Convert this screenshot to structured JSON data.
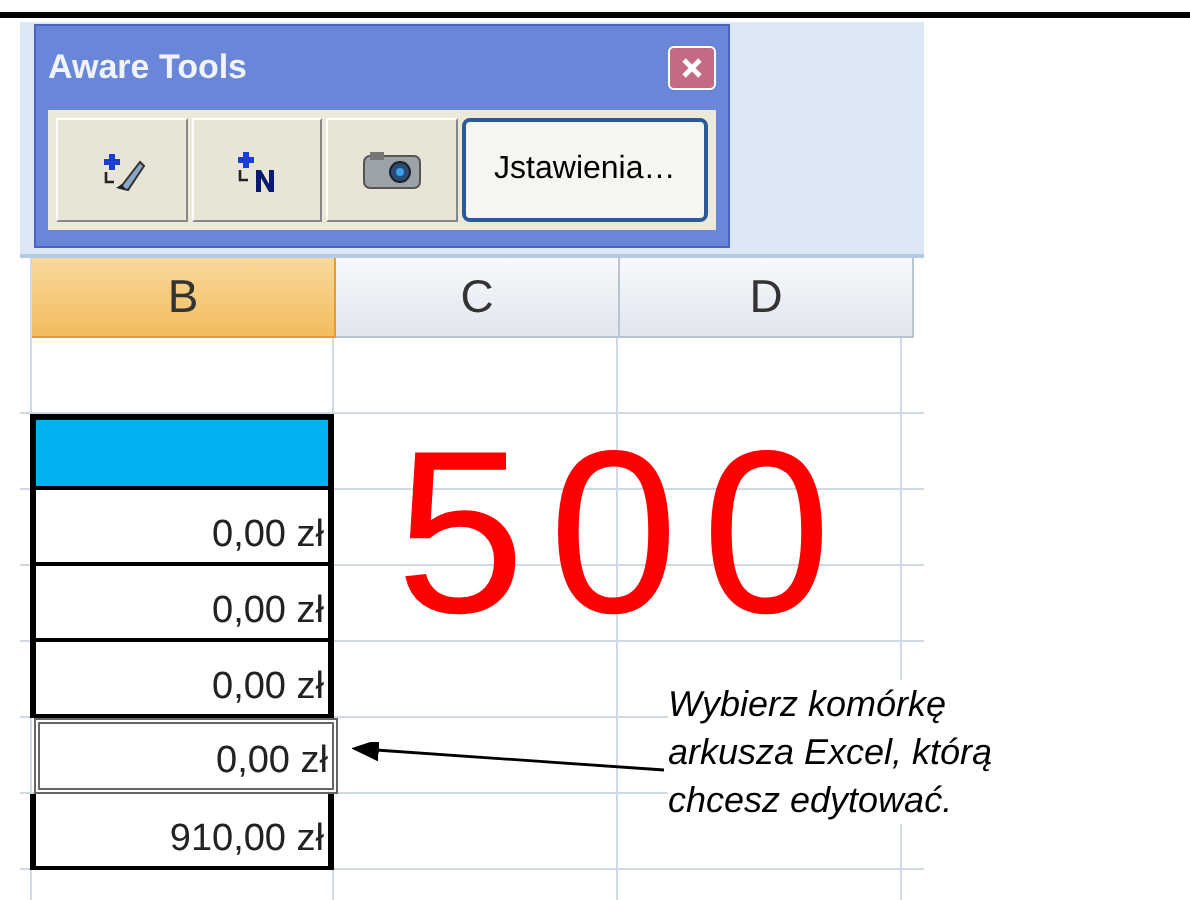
{
  "toolbar_window": {
    "title": "Aware Tools",
    "buttons": [
      {
        "kind": "icon"
      },
      {
        "kind": "icon"
      },
      {
        "kind": "icon"
      },
      {
        "kind": "text",
        "label": "Jstawienia…"
      }
    ]
  },
  "columns": [
    {
      "label": "B",
      "selected": true
    },
    {
      "label": "C",
      "selected": false
    },
    {
      "label": "D",
      "selected": false
    }
  ],
  "column_b_cells": [
    {
      "kind": "fill",
      "color": "#00b0f0"
    },
    {
      "kind": "value",
      "text": "0,00 zł",
      "selected": false
    },
    {
      "kind": "value",
      "text": "0,00 zł",
      "selected": false
    },
    {
      "kind": "value",
      "text": "0,00 zł",
      "selected": false
    },
    {
      "kind": "value",
      "text": "0,00 zł",
      "selected": true
    },
    {
      "kind": "value",
      "text": "910,00 zł",
      "selected": false
    }
  ],
  "handwritten_note": "500",
  "callout": "Wybierz komórkę arkusza Excel, którą chcesz edytować."
}
